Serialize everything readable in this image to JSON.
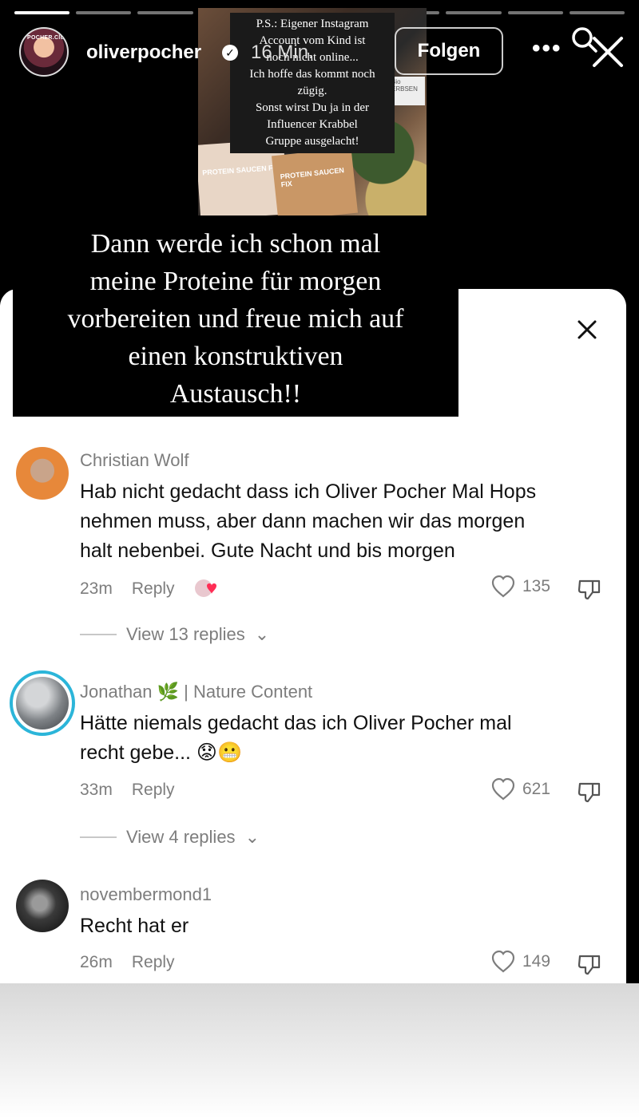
{
  "story": {
    "progress_segments": 10,
    "current_segment": 1,
    "username": "oliverpocher",
    "verified_badge": "✓",
    "time": "16 Min.",
    "avatar_label": "POCHER.Club",
    "follow_label": "Folgen",
    "more_label": "•••",
    "icons": {
      "search": "search-icon",
      "close": "close-icon",
      "more": "more-options-icon"
    }
  },
  "embedded_image": {
    "note_lines": [
      "P.S.: Eigener Instagram",
      "Account vom Kind ist",
      "noch nicht online...",
      "Ich hoffe das kommt noch",
      "zügig.",
      "Sonst wirst Du ja in der",
      "Influencer Krabbel",
      "Gruppe ausgelacht!"
    ],
    "package_label_1": "PROTEIN SAUCEN FIX",
    "package_label_2": "PROTEIN SAUCEN FIX",
    "bio_label": "Bio ERBSEN"
  },
  "caption": {
    "lines": [
      "Dann werde ich schon mal",
      "meine Proteine für morgen",
      "vorbereiten und freue mich auf",
      "einen konstruktiven",
      "Austausch!!"
    ]
  },
  "comments": [
    {
      "user": "Christian Wolf",
      "lines": [
        "Hab nicht gedacht dass ich Oliver Pocher Mal Hops",
        "nehmen muss, aber dann machen wir das morgen",
        "halt nebenbei. Gute Nacht und bis morgen"
      ],
      "time": "23m",
      "reply": "Reply",
      "likes": "135",
      "view_replies": "View 13 replies"
    },
    {
      "user": "Jonathan 🌿 | Nature Content",
      "lines": [
        "Hätte niemals gedacht das ich Oliver Pocher mal",
        "recht gebe... 😟😬"
      ],
      "time": "33m",
      "reply": "Reply",
      "likes": "621",
      "view_replies": "View 4 replies"
    },
    {
      "user": "novembermond1",
      "lines": [
        "Recht hat er"
      ],
      "time": "26m",
      "reply": "Reply",
      "likes": "149"
    }
  ],
  "colors": {
    "background": "#000000",
    "sheet": "#ffffff",
    "secondary_text": "#7d7d7d",
    "primary_text": "#111111",
    "creator_like_heart": "#ff2d55",
    "jonathan_ring": "#2bb5d9"
  }
}
